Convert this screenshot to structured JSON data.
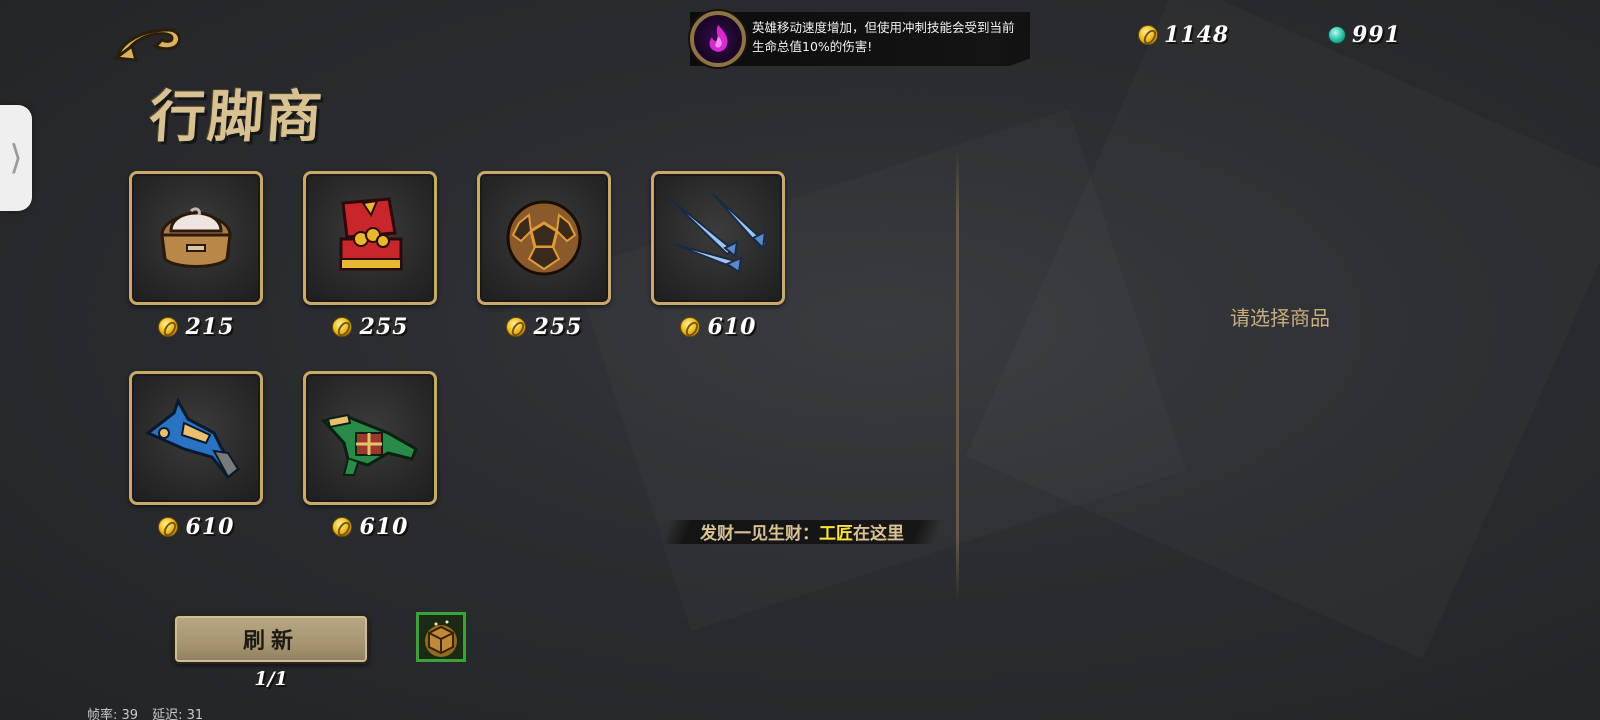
{
  "shop": {
    "title": "行脚商"
  },
  "buff": {
    "description": "英雄移动速度增加，但使用冲刺技能会受到当前生命总值10%的伤害!",
    "icon": "purple-flame-icon"
  },
  "currencies": {
    "gold": "1148",
    "gems": "991"
  },
  "items": [
    {
      "name": "steamed-bun-basket",
      "price": "215"
    },
    {
      "name": "red-treasure-chest",
      "price": "255"
    },
    {
      "name": "bronze-hex-ball",
      "price": "255"
    },
    {
      "name": "ice-claw-blades",
      "price": "610"
    },
    {
      "name": "blue-gold-blaster",
      "price": "610"
    },
    {
      "name": "green-gift-blaster",
      "price": "610"
    }
  ],
  "detail": {
    "placeholder": "请选择商品"
  },
  "tip": {
    "prefix": "发财一见生财：",
    "highlight": "工匠",
    "suffix": "在这里"
  },
  "refresh": {
    "label": "刷新",
    "count": "1/1"
  },
  "stats": {
    "fps": "帧率: 39",
    "latency": "延迟: 31"
  },
  "colors": {
    "card_border": "#c9a96a",
    "accent_gold": "#d8c294",
    "highlight": "#ffe23a"
  }
}
